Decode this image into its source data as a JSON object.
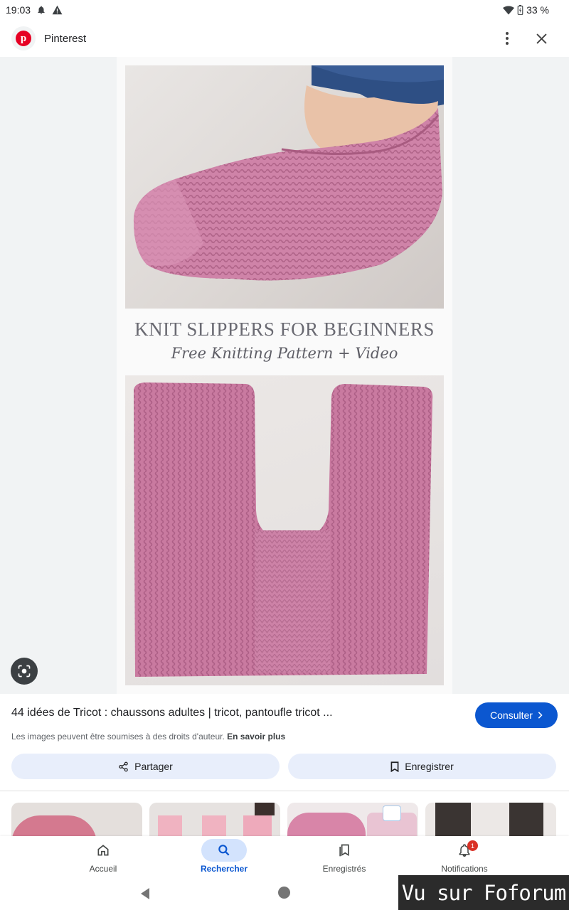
{
  "status_bar": {
    "time": "19:03",
    "battery": "33 %",
    "icons": [
      "notification-bell-icon",
      "warning-icon",
      "wifi-icon",
      "battery-charging-icon"
    ]
  },
  "header": {
    "site_name": "Pinterest",
    "icons": [
      "pinterest-logo-icon",
      "more-vert-icon",
      "close-icon"
    ]
  },
  "image": {
    "caption_main": "KNIT SLIPPERS FOR BEGINNERS",
    "caption_sub": "Free Knitting Pattern + Video",
    "colors": {
      "knit_pink": "#c9799f",
      "knit_pink_light": "#d98fb3",
      "jeans": "#2e4f84"
    }
  },
  "result": {
    "title": "44 idées de Tricot : chaussons adultes | tricot, pantoufle tricot ...",
    "visit_label": "Consulter",
    "copyright_text": "Les images peuvent être soumises à des droits d'auteur.",
    "learn_more": "En savoir plus",
    "share_label": "Partager",
    "save_label": "Enregistrer"
  },
  "bottom_nav": {
    "items": [
      {
        "label": "Accueil",
        "icon": "home-icon"
      },
      {
        "label": "Rechercher",
        "icon": "search-icon",
        "active": true
      },
      {
        "label": "Enregistrés",
        "icon": "bookmarks-icon"
      },
      {
        "label": "Notifications",
        "icon": "bell-icon",
        "badge": "1"
      }
    ]
  },
  "watermark": "Vu sur Foforum",
  "colors": {
    "accent": "#0b57d0",
    "accent_light": "#d3e3fd",
    "chip_bg": "#e8eefb",
    "badge": "#d93025"
  }
}
